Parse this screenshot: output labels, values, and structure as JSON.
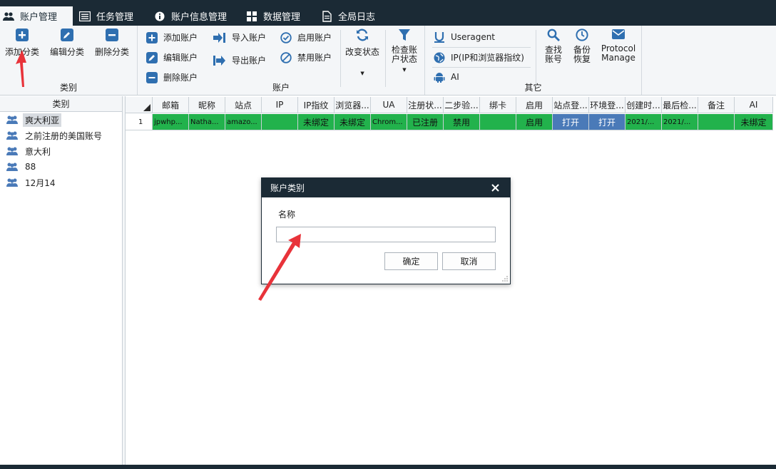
{
  "tabs": [
    {
      "label": "账户管理",
      "icon": "users-icon",
      "active": true
    },
    {
      "label": "任务管理",
      "icon": "list-icon"
    },
    {
      "label": "账户信息管理",
      "icon": "info-icon"
    },
    {
      "label": "数据管理",
      "icon": "grid-icon"
    },
    {
      "label": "全局日志",
      "icon": "document-icon"
    }
  ],
  "ribbon": {
    "category": {
      "label": "类别",
      "add": "添加分类",
      "edit": "编辑分类",
      "delete": "删除分类"
    },
    "account": {
      "label": "账户",
      "add": "添加账户",
      "edit": "编辑账户",
      "delete": "删除账户",
      "import": "导入账户",
      "export": "导出账户",
      "enable": "启用账户",
      "disable": "禁用账户",
      "change_status": "改变状态",
      "check_status": "检查账户状态"
    },
    "other": {
      "label": "其它",
      "useragent": "Useragent",
      "ip": "IP(IP和浏览器指纹)",
      "ai": "AI",
      "find": "查找账号",
      "backup": "备份恢复",
      "protocol": "Protocol Manage"
    }
  },
  "categories": {
    "header": "类别",
    "items": [
      "爽大利亚",
      "之前注册的美国账号",
      "意大利",
      "88",
      "12月14"
    ]
  },
  "grid": {
    "columns": [
      "邮箱",
      "昵称",
      "站点",
      "IP",
      "IP指纹",
      "浏览器...",
      "UA",
      "注册状...",
      "二步验...",
      "绑卡",
      "启用",
      "站点登...",
      "环境登...",
      "创建时...",
      "最后检...",
      "备注",
      "AI"
    ],
    "rows": [
      [
        "1",
        "jpwhp...",
        "Natha...",
        "amazo...",
        "",
        "未绑定",
        "未绑定",
        "Chrom...",
        "已注册",
        "禁用",
        "",
        "启用",
        "打开",
        "打开",
        "2021/...",
        "2021/...",
        "",
        "未绑定"
      ]
    ]
  },
  "dialog": {
    "title": "账户类别",
    "name_label": "名称",
    "name_value": "",
    "ok": "确定",
    "cancel": "取消"
  },
  "colors": {
    "dark": "#1b2a35",
    "accent_blue": "#2f6fb0",
    "row_green": "#22b24c",
    "cell_blue": "#4a7ab8",
    "arrow_red": "#e8333a"
  }
}
